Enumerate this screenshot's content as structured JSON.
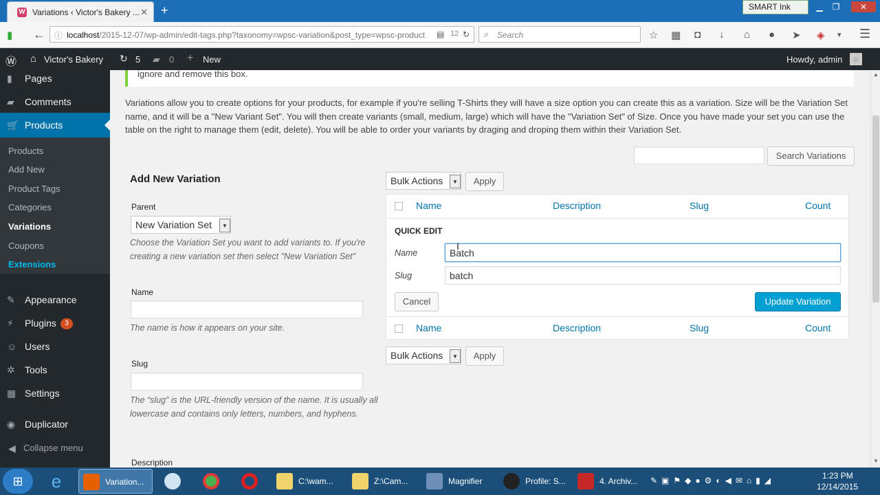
{
  "browser": {
    "tab_title": "Variations ‹ Victor's Bakery ...",
    "tab_close": "✕",
    "new_tab": "+",
    "url_host": "localhost",
    "url_path": "/2015-12-07/wp-admin/edit-tags.php?taxonomy=wpsc-variation&post_type=wpsc-product",
    "search_placeholder": "Search",
    "smart_ink": "SMART Ink"
  },
  "adminbar": {
    "site_name": "Victor's Bakery",
    "updates_count": "5",
    "comments_count": "0",
    "new_label": "New",
    "howdy": "Howdy, admin"
  },
  "sidebar": {
    "menu_top": [
      {
        "label": "Pages"
      },
      {
        "label": "Comments"
      },
      {
        "label": "Products"
      }
    ],
    "sub": [
      {
        "label": "Products"
      },
      {
        "label": "Add New"
      },
      {
        "label": "Product Tags"
      },
      {
        "label": "Categories"
      },
      {
        "label": "Variations"
      },
      {
        "label": "Coupons"
      },
      {
        "label": "Extensions"
      }
    ],
    "menu_bottom": [
      {
        "label": "Appearance"
      },
      {
        "label": "Plugins"
      },
      {
        "label": "Users"
      },
      {
        "label": "Tools"
      },
      {
        "label": "Settings"
      },
      {
        "label": "Duplicator"
      }
    ],
    "plugins_badge": "3",
    "collapse": "Collapse menu"
  },
  "main": {
    "notice_text": "ignore and remove this box.",
    "intro": "Variations allow you to create options for your products, for example if you're selling T-Shirts they will have a size option you can create this as a variation. Size will be the Variation Set name, and it will be a \"New Variant Set\". You will then create variants (small, medium, large) which will have the \"Variation Set\" of Size. Once you have made your set you can use the table on the right to manage them (edit, delete). You will be able to order your variants by draging and droping them within their Variation Set.",
    "search_button": "Search Variations",
    "add_title": "Add New Variation",
    "parent_label": "Parent",
    "parent_value": "New Variation Set",
    "parent_desc": "Choose the Variation Set you want to add variants to. If you're creating a new variation set then select \"New Variation Set\"",
    "name_label": "Name",
    "name_desc": "The name is how it appears on your site.",
    "slug_label": "Slug",
    "slug_desc": "The “slug” is the URL-friendly version of the name. It is usually all lowercase and contains only letters, numbers, and hyphens.",
    "description_label": "Description",
    "bulk_actions": "Bulk Actions",
    "apply": "Apply",
    "columns": {
      "name": "Name",
      "description": "Description",
      "slug": "Slug",
      "count": "Count"
    },
    "quick_edit": {
      "title": "QUICK EDIT",
      "name_label": "Name",
      "name_value": "Batch",
      "slug_label": "Slug",
      "slug_value": "batch",
      "cancel": "Cancel",
      "update": "Update Variation"
    }
  },
  "taskbar": {
    "items": [
      {
        "label": "Variation..."
      },
      {
        "label": "C:\\wam..."
      },
      {
        "label": "Z:\\Cam..."
      },
      {
        "label": "Magnifier"
      },
      {
        "label": "Profile: S..."
      },
      {
        "label": "4. Archiv..."
      }
    ],
    "time": "1:23 PM",
    "date": "12/14/2015"
  },
  "colors": {
    "accent": "#0073aa",
    "wp_dark": "#23282d",
    "wp_active": "#0073aa",
    "update_button": "#00a0d2",
    "notice_border": "#7ad03a",
    "taskbar": "#1b4f7a"
  }
}
